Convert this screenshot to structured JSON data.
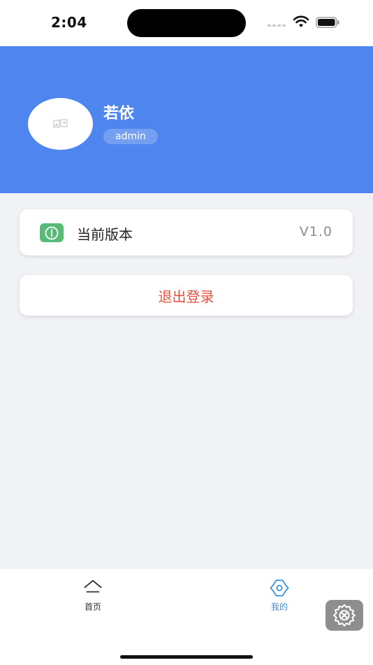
{
  "status_bar": {
    "time": "2:04"
  },
  "profile": {
    "name": "若依",
    "role": "admin"
  },
  "menu": {
    "version_label": "当前版本",
    "version_value": "V1.0",
    "logout_label": "退出登录"
  },
  "tabs": [
    {
      "label": "首页",
      "icon": "home-icon",
      "active": false
    },
    {
      "label": "我的",
      "icon": "settings-icon",
      "active": true
    }
  ],
  "colors": {
    "header": "#4f85ee",
    "version_icon": "#57bb77",
    "logout_text": "#e8503c",
    "active_tab": "#3b8fe6"
  }
}
